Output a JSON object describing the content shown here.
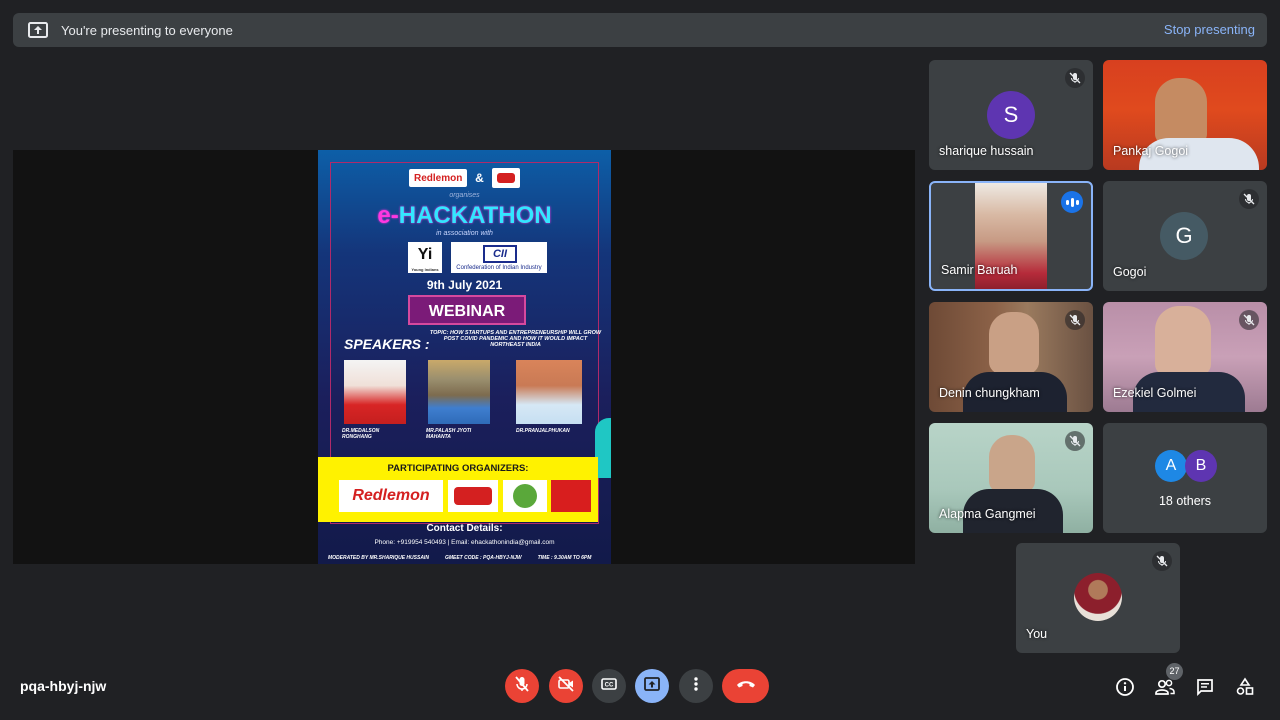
{
  "banner": {
    "text": "You're presenting to everyone",
    "stop_label": "Stop presenting",
    "icon": "present-screen-icon"
  },
  "poster": {
    "logo_a": "Redlemon",
    "amp": "&",
    "organises": "organises",
    "title_prefix": "e-",
    "title_main": "HACKATHON",
    "assoc": "in association with",
    "yi": "Yi",
    "yi_sub": "Young Indians",
    "cii": "CII",
    "cii_text": "Confederation of Indian Industry",
    "date": "9th July 2021",
    "webinar": "WEBINAR",
    "topic": "TOPIC: HOW STARTUPS AND ENTREPRENEURSHIP WILL GROW POST COVID PANDEMIC AND HOW IT WOULD IMPACT NORTHEAST INDIA",
    "speakers_heading": "SPEAKERS :",
    "speakers": [
      {
        "name": "DR.MEDALSON RONGHANG"
      },
      {
        "name": "MR.PALASH JYOTI MAHANTA"
      },
      {
        "name": "DR.PRANJALPHUKAN"
      }
    ],
    "participating": "PARTICIPATING ORGANIZERS:",
    "org1": "Redlemon",
    "contact_heading": "Contact Details:",
    "contact_line": "Phone: +919954 540493  |  Email: ehackathonindia@gmail.com",
    "moderated": "MODERATED BY  MR.SHARIQUE HUSSAIN",
    "gmeet": "GMEET CODE : PQA-HBYJ-NJW",
    "time": "TIME : 9.30AM TO 6PM"
  },
  "participants": [
    {
      "name": "sharique hussain",
      "initial": "S",
      "avatar_color": "#5e35b1",
      "muted": true
    },
    {
      "name": "Pankaj Gogoi",
      "muted": false
    },
    {
      "name": "Samir Baruah",
      "speaking": true
    },
    {
      "name": "Gogoi",
      "initial": "G",
      "avatar_color": "#455a64",
      "muted": true
    },
    {
      "name": "Denin chungkham",
      "muted": true
    },
    {
      "name": "Ezekiel Golmei",
      "muted": true
    },
    {
      "name": "Alapma Gangmei",
      "muted": true
    },
    {
      "others_label": "18 others",
      "initials": [
        "A",
        "B"
      ],
      "colors": [
        "#1e88e5",
        "#5e35b1"
      ]
    },
    {
      "name": "You",
      "muted": true
    }
  ],
  "bottom": {
    "meeting_code": "pqa-hbyj-njw",
    "people_count": "27",
    "controls": [
      "mic-off-icon",
      "camera-off-icon",
      "captions-icon",
      "present-icon",
      "more-icon",
      "hangup-icon"
    ],
    "right_icons": [
      "info-icon",
      "people-icon",
      "chat-icon",
      "activities-icon"
    ]
  },
  "colors": {
    "background": "#202124",
    "tile": "#3c4043",
    "accent_blue": "#8ab4f8",
    "danger_red": "#ea4335"
  }
}
